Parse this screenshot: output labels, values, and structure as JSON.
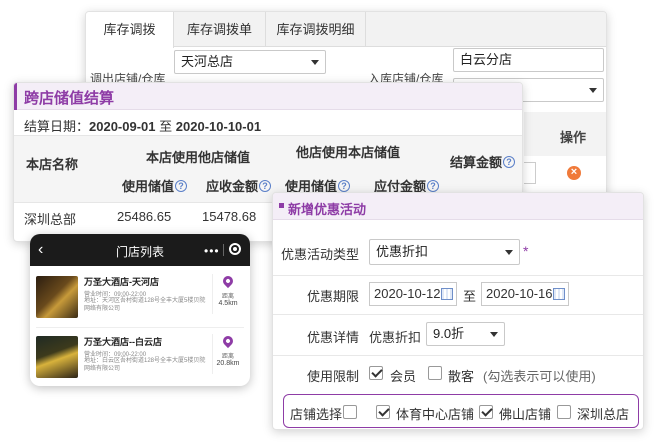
{
  "transfer": {
    "tabs": [
      "库存调拨",
      "库存调拨单",
      "库存调拨明细"
    ],
    "out_store_label": "调出店铺/仓库",
    "out_store_value": "天河总店",
    "in_store_label": "入库店铺/仓库",
    "in_store_value": "白云分店",
    "action_header": "操作"
  },
  "cross": {
    "title": "跨店储值结算",
    "period_label": "结算日期：",
    "period_from": "2020-09-01",
    "period_sep": "至",
    "period_to": "2020-10-10-01",
    "header_store": "本店名称",
    "header_group1": "本店使用他店储值",
    "header_group2": "他店使用本店储值",
    "header_settle": "结算金额",
    "sub_used": "使用储值",
    "sub_receivable": "应收金额",
    "sub_used2": "使用储值",
    "sub_payable": "应付金额",
    "row_store": "深圳总部",
    "row_used": "25486.65",
    "row_receivable": "15478.68"
  },
  "phone": {
    "title": "门店列表",
    "stores": [
      {
        "name": "万圣大酒店-天河店",
        "hours": "营业时间：09:00-22:00",
        "address": "地址：天河区吾村街道128号全丰大厦5楼贝院网络有限公司",
        "distance_label": "距离",
        "distance": "4.5km"
      },
      {
        "name": "万圣大酒店--白云店",
        "hours": "营业时间：09:00-22:00",
        "address": "地址：白云区吾村街道128号全丰大厦5楼贝院网络有限公司",
        "distance_label": "距离",
        "distance": "20.8km"
      }
    ]
  },
  "promo": {
    "title": "新增优惠活动",
    "type_label": "优惠活动类型",
    "type_value": "优惠折扣",
    "required_mark": "*",
    "period_label": "优惠期限",
    "date_from": "2020-10-12",
    "date_sep": "至",
    "date_to": "2020-10-16",
    "detail_label": "优惠详情",
    "detail_prefix": "优惠折扣",
    "detail_value": "9.0折",
    "limit_label": "使用限制",
    "member_label": "会员",
    "guest_label": "散客",
    "limit_hint": "(勾选表示可以使用)",
    "store_label": "店铺选择",
    "store1": "体育中心店铺",
    "store2": "佛山店铺",
    "store3": "深圳总店",
    "colors": {
      "accent": "#8e3ca6"
    }
  }
}
